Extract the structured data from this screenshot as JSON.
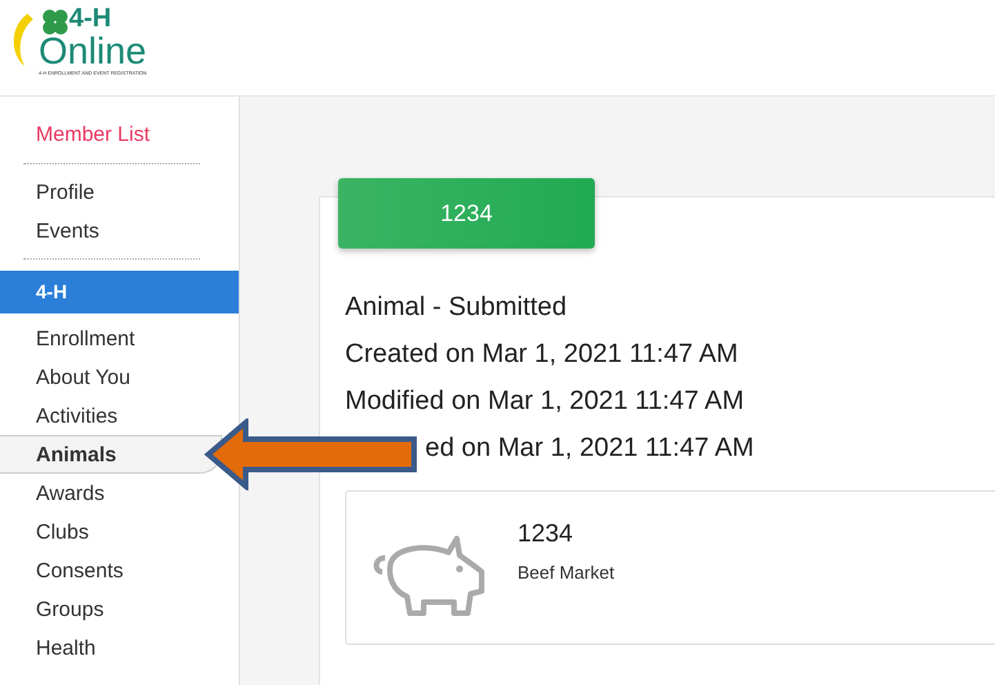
{
  "logo": {
    "title": "4-H",
    "subtitle": "Online",
    "tagline": "4-H ENROLLMENT AND EVENT REGISTRATION"
  },
  "sidebar": {
    "top_link": "Member List",
    "items": [
      {
        "label": "Profile",
        "selected": false
      },
      {
        "label": "Events",
        "selected": false
      }
    ],
    "section": {
      "label": "4-H",
      "items": [
        {
          "label": "Enrollment",
          "selected": false
        },
        {
          "label": "About You",
          "selected": false
        },
        {
          "label": "Activities",
          "selected": false
        },
        {
          "label": "Animals",
          "selected": true
        },
        {
          "label": "Awards",
          "selected": false
        },
        {
          "label": "Clubs",
          "selected": false
        },
        {
          "label": "Consents",
          "selected": false
        },
        {
          "label": "Groups",
          "selected": false
        },
        {
          "label": "Health",
          "selected": false
        }
      ]
    }
  },
  "record": {
    "button": "1234",
    "status": "Animal - Submitted",
    "details": [
      "Created on Mar 1, 2021 11:47 AM",
      "Modified on Mar 1, 2021 11:47 AM",
      "ed on Mar 1, 2021 11:47 AM"
    ],
    "animal": {
      "name": "1234",
      "type": "Beef Market"
    }
  }
}
